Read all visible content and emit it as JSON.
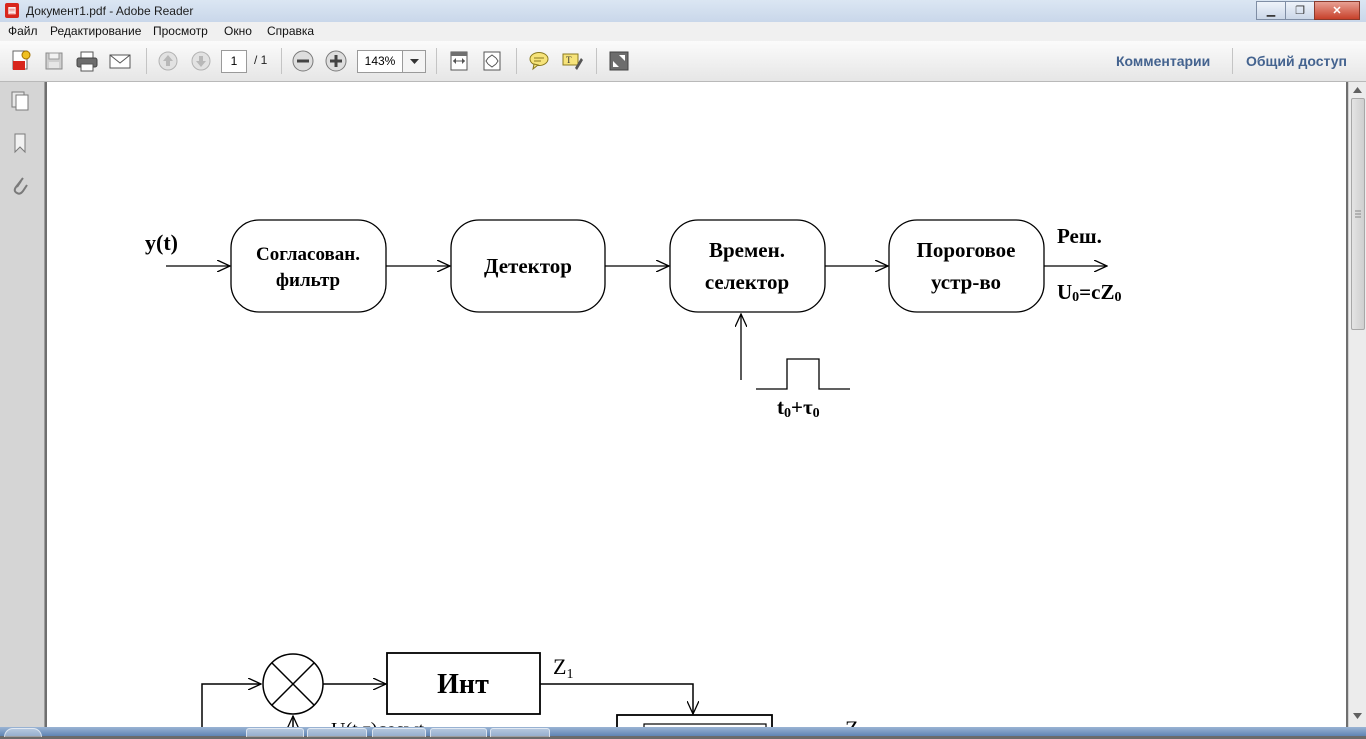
{
  "window": {
    "title": "Документ1.pdf - Adobe Reader",
    "app_icon": "pdf-icon",
    "minimize_glyph": "▁",
    "maximize_glyph": "❐",
    "close_glyph": "✕"
  },
  "menu": [
    "Файл",
    "Редактирование",
    "Просмотр",
    "Окно",
    "Справка"
  ],
  "toolbar": {
    "page_current": "1",
    "page_total": "/ 1",
    "zoom": "143%",
    "comments_label": "Комментарии",
    "share_label": "Общий доступ"
  },
  "diagram1": {
    "input_label": "y(t)",
    "blocks": [
      {
        "line1": "Согласован.",
        "line2": "фильтр"
      },
      {
        "line1": "Детектор",
        "line2": ""
      },
      {
        "line1": "Времен.",
        "line2": "селектор"
      },
      {
        "line1": "Пороговое",
        "line2": "устр-во"
      }
    ],
    "output_label_top": "Реш.",
    "output_label_bottom_main": "U",
    "output_label_bottom_sub1": "0",
    "output_label_bottom_mid": "=cZ",
    "output_label_bottom_sub2": "0",
    "pulse_label_t": "t",
    "pulse_label_sub1": "0",
    "pulse_label_plus": "+τ",
    "pulse_label_sub2": "0"
  },
  "diagram2": {
    "integrator_label": "Инт",
    "z1_label": "Z",
    "z1_sub": "1",
    "partial_label": "U(t,τ",
    "partial_label_rest": ")cosw",
    "partial_label_t": "t",
    "z_partial": "Z"
  },
  "colors": {
    "accent_link": "#44638f",
    "pdf_red": "#d8261c",
    "page_bg": "#ffffff",
    "workspace": "#6f6f6f"
  }
}
